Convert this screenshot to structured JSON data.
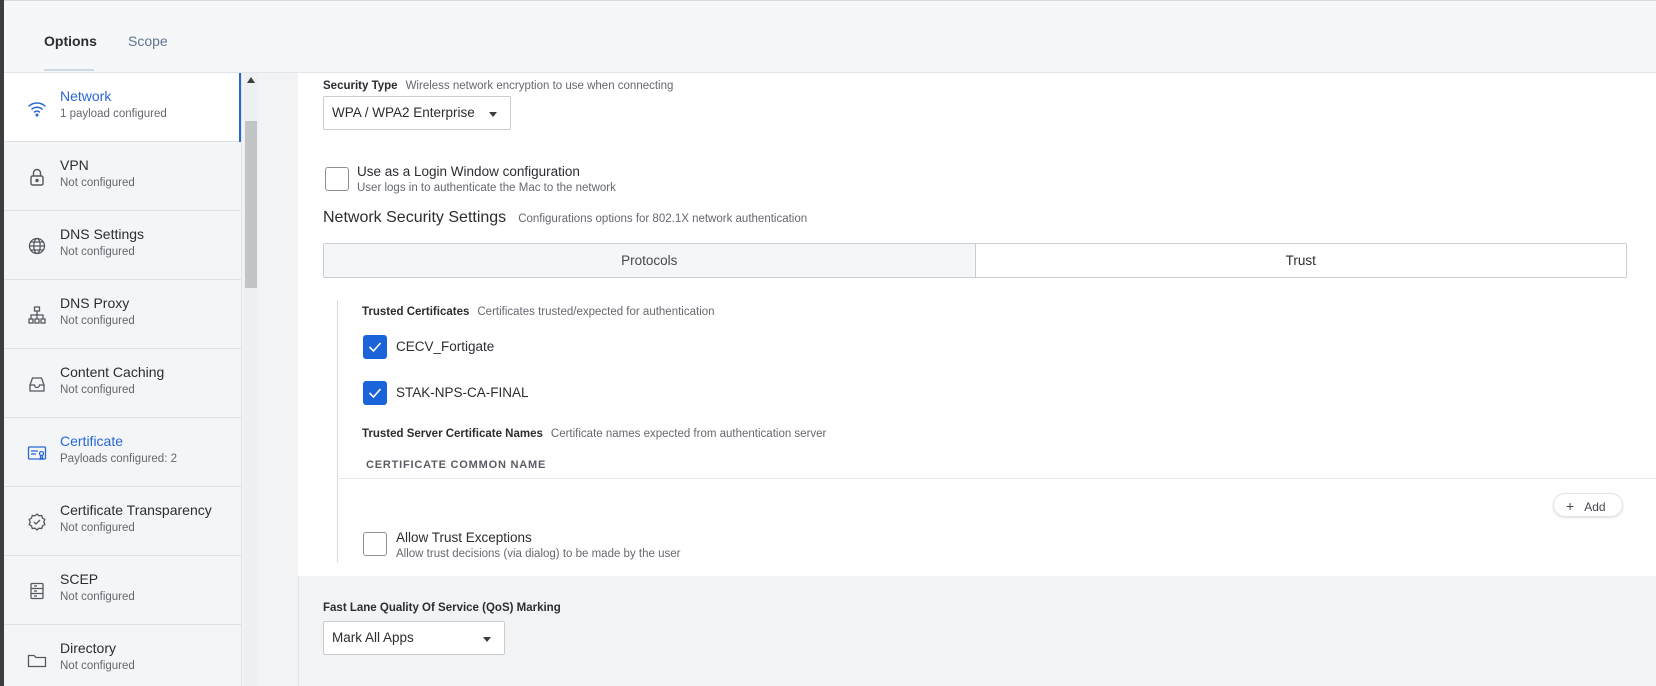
{
  "tabs": [
    {
      "label": "Options"
    },
    {
      "label": "Scope"
    }
  ],
  "sidebar": {
    "items": [
      {
        "label": "Network",
        "status": "1 payload configured",
        "icon": "wifi-icon"
      },
      {
        "label": "VPN",
        "status": "Not configured",
        "icon": "lock-icon"
      },
      {
        "label": "DNS Settings",
        "status": "Not configured",
        "icon": "globe-icon"
      },
      {
        "label": "DNS Proxy",
        "status": "Not configured",
        "icon": "hierarchy-icon"
      },
      {
        "label": "Content Caching",
        "status": "Not configured",
        "icon": "tray-icon"
      },
      {
        "label": "Certificate",
        "status": "Payloads configured: 2",
        "icon": "certificate-icon"
      },
      {
        "label": "Certificate Transparency",
        "status": "Not configured",
        "icon": "badge-check-icon"
      },
      {
        "label": "SCEP",
        "status": "Not configured",
        "icon": "server-icon"
      },
      {
        "label": "Directory",
        "status": "Not configured",
        "icon": "folder-icon"
      }
    ]
  },
  "security_type": {
    "label": "Security Type",
    "help": "Wireless network encryption to use when connecting",
    "value": "WPA / WPA2 Enterprise"
  },
  "login_window": {
    "label": "Use as a Login Window configuration",
    "help": "User logs in to authenticate the Mac to the network",
    "checked": false
  },
  "network_security": {
    "title": "Network Security Settings",
    "help": "Configurations options for 802.1X network authentication",
    "tabs": [
      "Protocols",
      "Trust"
    ],
    "selected_tab": "Trust"
  },
  "trusted_certificates": {
    "label": "Trusted Certificates",
    "help": "Certificates trusted/expected for authentication",
    "items": [
      {
        "name": "CECV_Fortigate",
        "checked": true
      },
      {
        "name": "STAK-NPS-CA-FINAL",
        "checked": true
      }
    ]
  },
  "trusted_server_names": {
    "label": "Trusted Server Certificate Names",
    "help": "Certificate names expected from authentication server",
    "column_header": "CERTIFICATE COMMON NAME",
    "add_label": "Add"
  },
  "trust_exceptions": {
    "label": "Allow Trust Exceptions",
    "help": "Allow trust decisions (via dialog) to be made by the user",
    "checked": false
  },
  "qos": {
    "label": "Fast Lane Quality Of Service (QoS) Marking",
    "value": "Mark All Apps"
  },
  "colors": {
    "accent": "#2a67d6",
    "checkbox": "#1a63d8"
  }
}
